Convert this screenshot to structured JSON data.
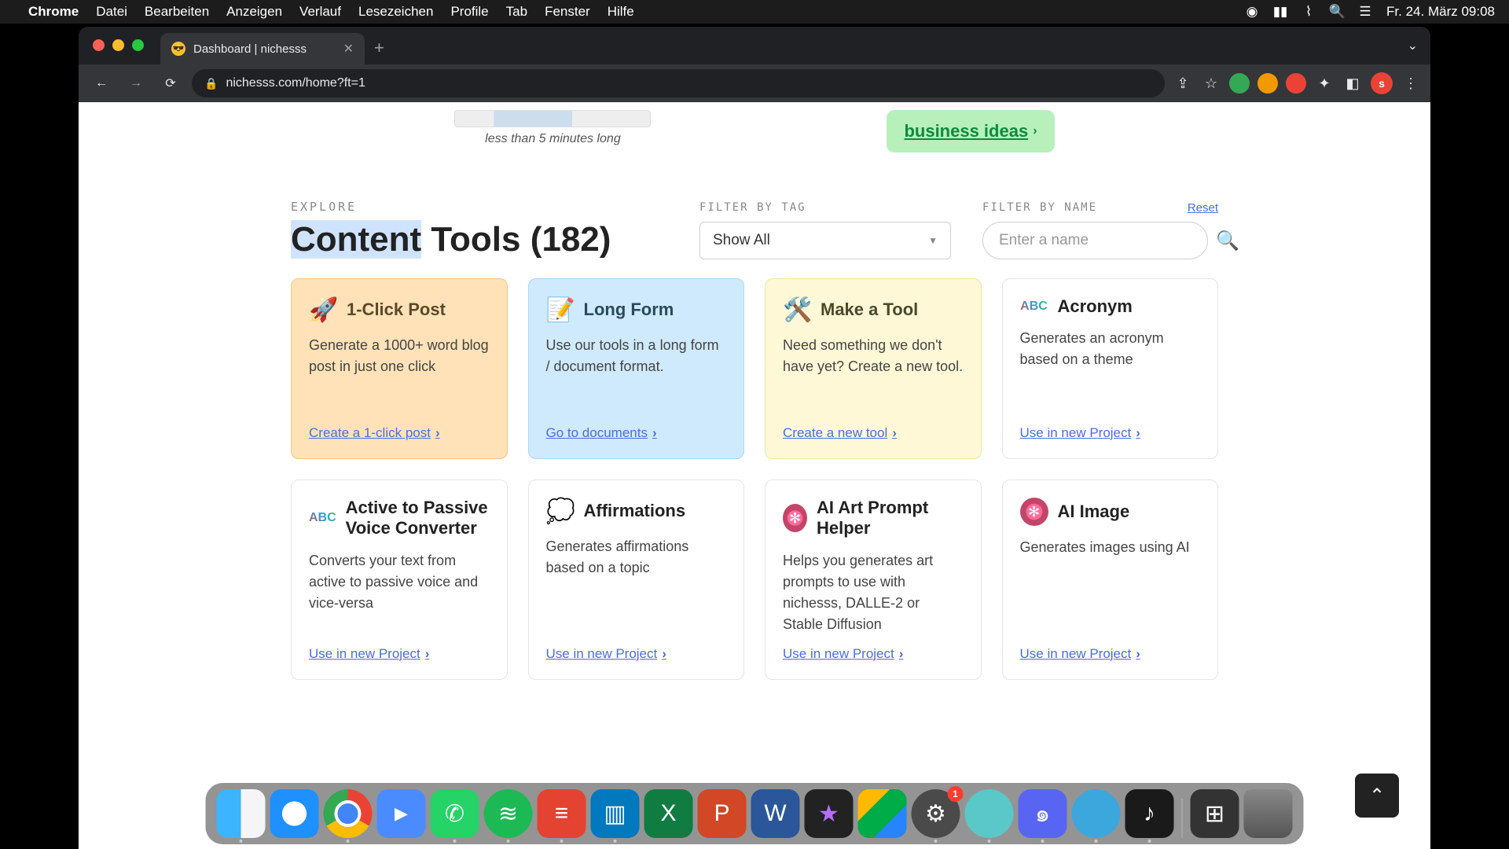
{
  "menubar": {
    "app": "Chrome",
    "items": [
      "Datei",
      "Bearbeiten",
      "Anzeigen",
      "Verlauf",
      "Lesezeichen",
      "Profile",
      "Tab",
      "Fenster",
      "Hilfe"
    ],
    "clock": "Fr. 24. März 09:08"
  },
  "browser": {
    "tab_title": "Dashboard | nichesss",
    "url": "nichesss.com/home?ft=1",
    "avatar_letter": "s"
  },
  "remnant": {
    "video_caption": "less than 5 minutes long",
    "biz_link": "business ideas"
  },
  "filters": {
    "explore_label": "EXPLORE",
    "title_hl": "Content",
    "title_rest": " Tools (182)",
    "tag_label": "FILTER BY TAG",
    "tag_value": "Show All",
    "name_label": "FILTER BY NAME",
    "reset": "Reset",
    "name_placeholder": "Enter a name"
  },
  "cards": [
    {
      "icon": "🚀",
      "title": "1-Click Post",
      "desc": "Generate a 1000+ word blog post in just one click",
      "link": "Create a 1-click post",
      "variant": "orange"
    },
    {
      "icon": "📝",
      "title": "Long Form",
      "desc": "Use our tools in a long form / document format.",
      "link": "Go to documents",
      "variant": "blue"
    },
    {
      "icon": "🛠️",
      "title": "Make a Tool",
      "desc": "Need something we don't have yet? Create a new tool.",
      "link": "Create a new tool",
      "variant": "yellow"
    },
    {
      "icon": "ABC",
      "title": "Acronym",
      "desc": "Generates an acronym based on a theme",
      "link": "Use in new Project",
      "variant": "plain",
      "iconClass": "abc"
    },
    {
      "icon": "ABC",
      "title": "Active to Passive Voice Converter",
      "desc": "Converts your text from active to passive voice and vice-versa",
      "link": "Use in new Project",
      "variant": "plain",
      "iconClass": "abc"
    },
    {
      "icon": "💭",
      "title": "Affirmations",
      "desc": "Generates affirmations based on a topic",
      "link": "Use in new Project",
      "variant": "plain"
    },
    {
      "icon": "✻",
      "title": "AI Art Prompt Helper",
      "desc": "Helps you generates art prompts to use with nichesss, DALLE-2 or Stable Diffusion",
      "link": "Use in new Project",
      "variant": "plain",
      "iconClass": "gear"
    },
    {
      "icon": "✻",
      "title": "AI Image",
      "desc": "Generates images using AI",
      "link": "Use in new Project",
      "variant": "plain",
      "iconClass": "gear"
    }
  ],
  "dock_badge": "1"
}
